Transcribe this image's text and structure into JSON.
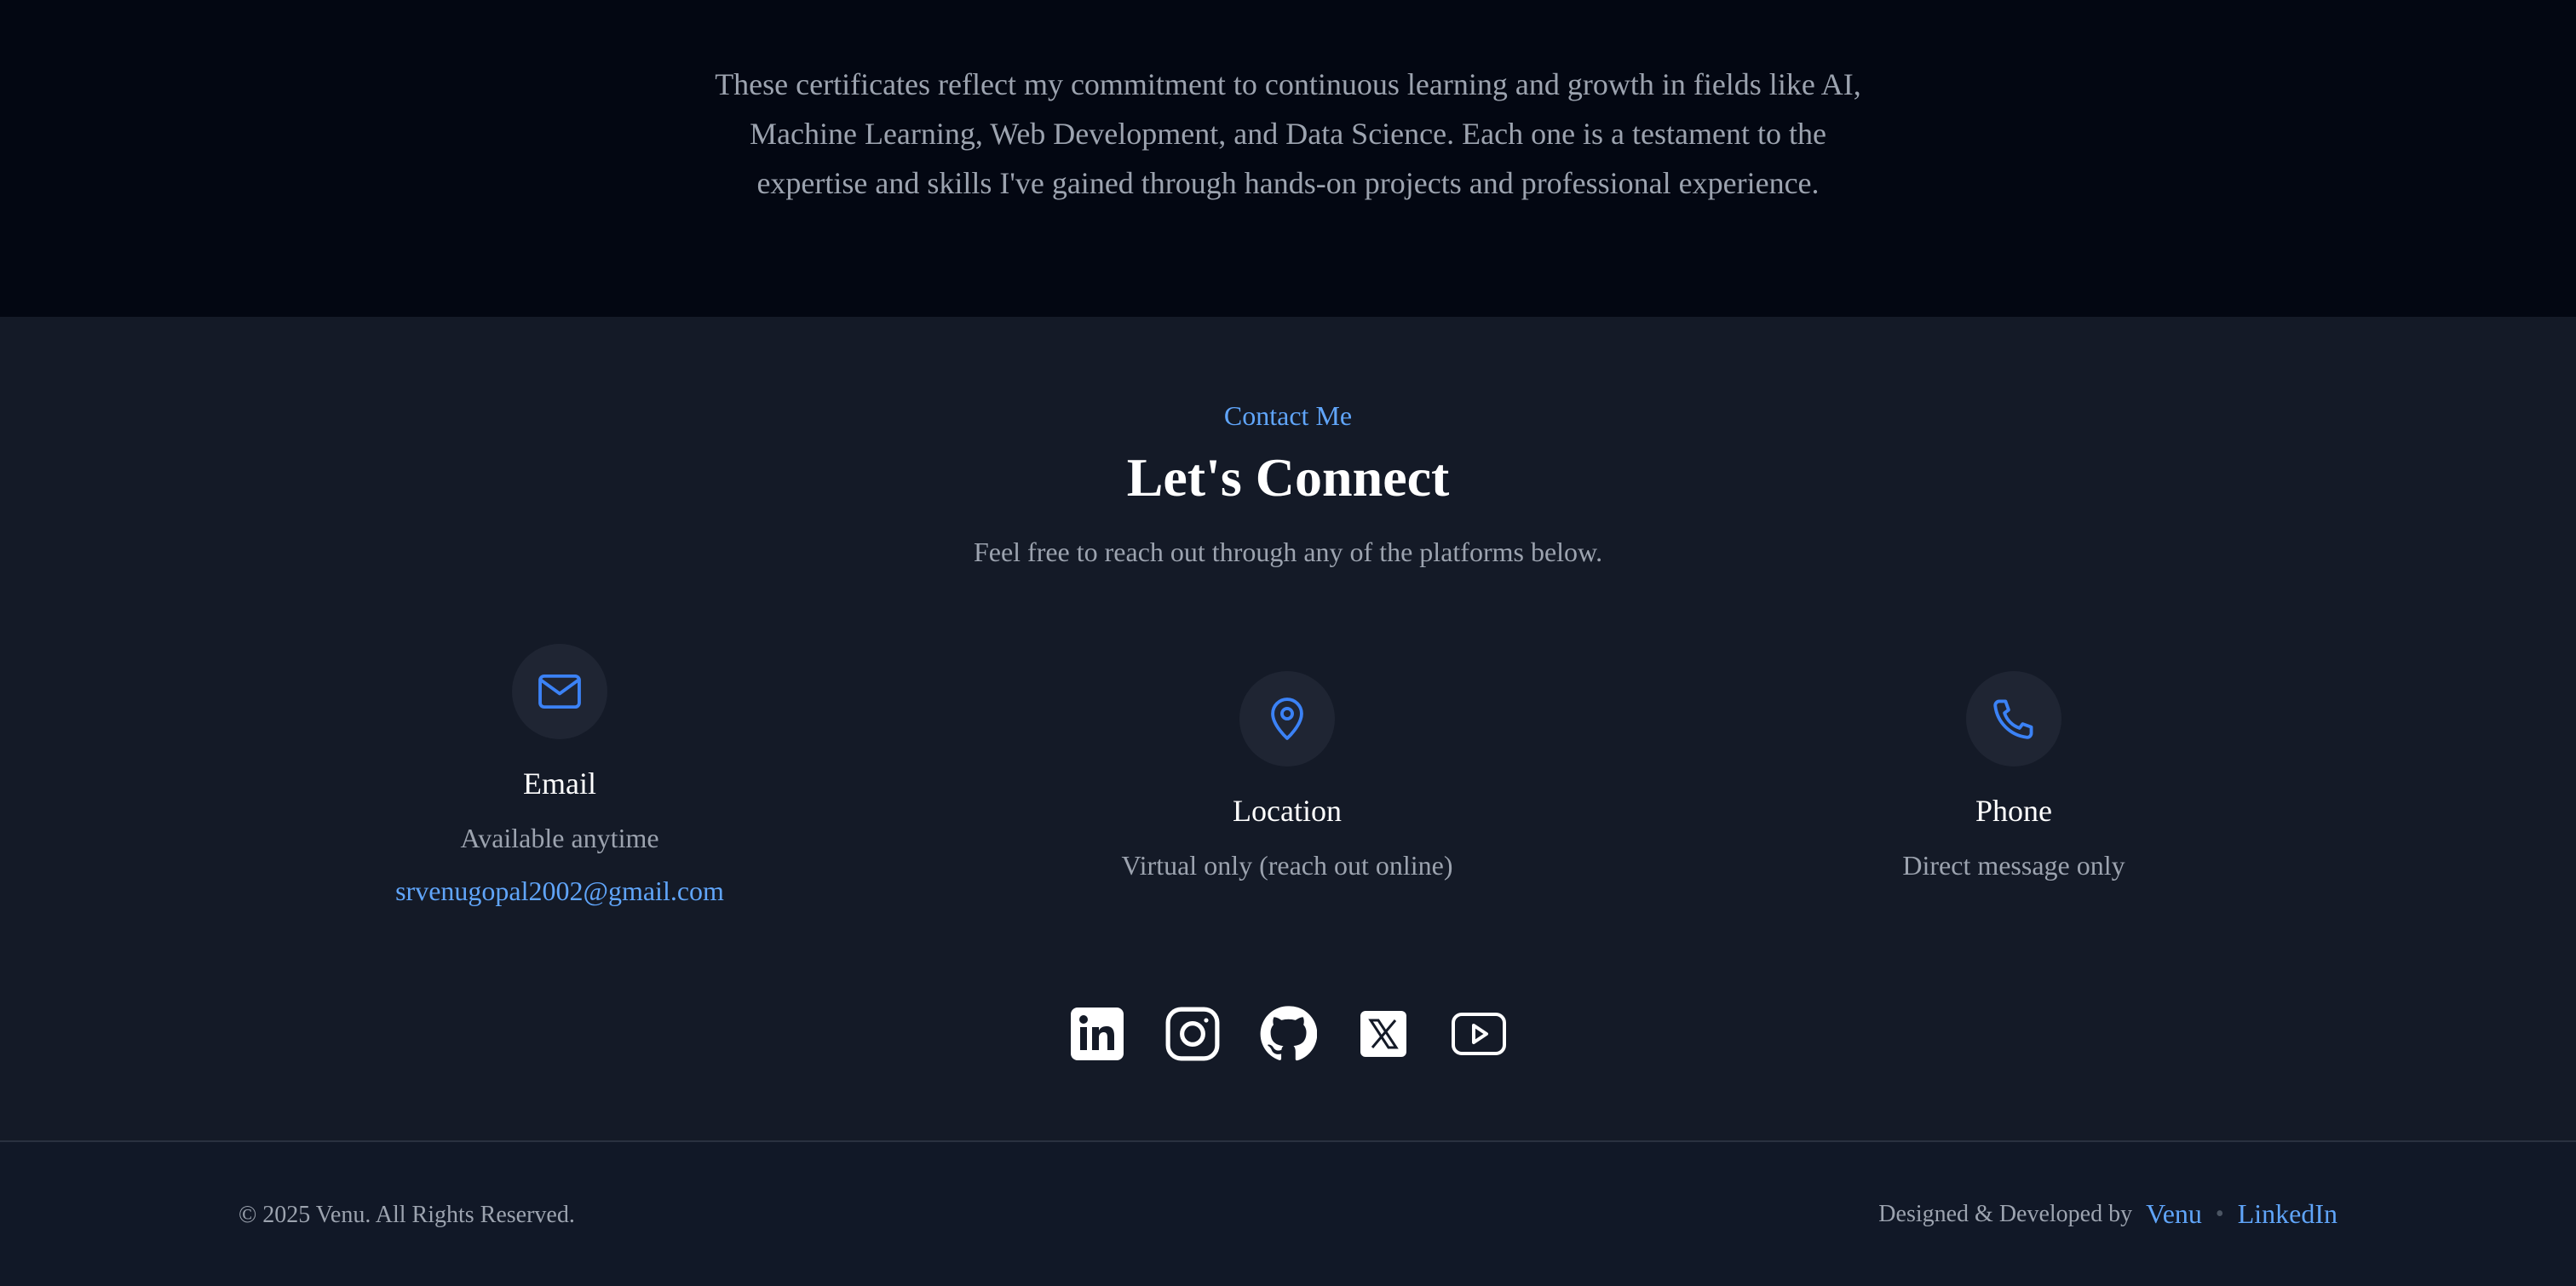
{
  "certificates": {
    "description": "These certificates reflect my commitment to continuous learning and growth in fields like AI, Machine Learning, Web Development, and Data Science. Each one is a testament to the expertise and skills I've gained through hands-on projects and professional experience."
  },
  "contact": {
    "eyebrow": "Contact Me",
    "heading": "Let's Connect",
    "subheading": "Feel free to reach out through any of the platforms below.",
    "cards": {
      "email": {
        "icon": "mail-icon",
        "title": "Email",
        "desc": "Available anytime",
        "link": "srvenugopal2002@gmail.com"
      },
      "location": {
        "icon": "map-pin-icon",
        "title": "Location",
        "desc": "Virtual only (reach out online)"
      },
      "phone": {
        "icon": "phone-icon",
        "title": "Phone",
        "desc": "Direct message only"
      }
    },
    "socials": [
      "linkedin-icon",
      "instagram-icon",
      "github-icon",
      "x-icon",
      "youtube-icon"
    ]
  },
  "footer": {
    "copyright": "© 2025 Venu. All Rights Reserved.",
    "credit_prefix": "Designed & Developed by",
    "credit_name": "Venu",
    "separator": "•",
    "credit_link": "LinkedIn"
  },
  "colors": {
    "accent": "#60a5fa",
    "icon_blue": "#3b82f6",
    "muted_text": "#9ca3af",
    "top_bg": "#030712",
    "section_bg": "#141a27"
  }
}
